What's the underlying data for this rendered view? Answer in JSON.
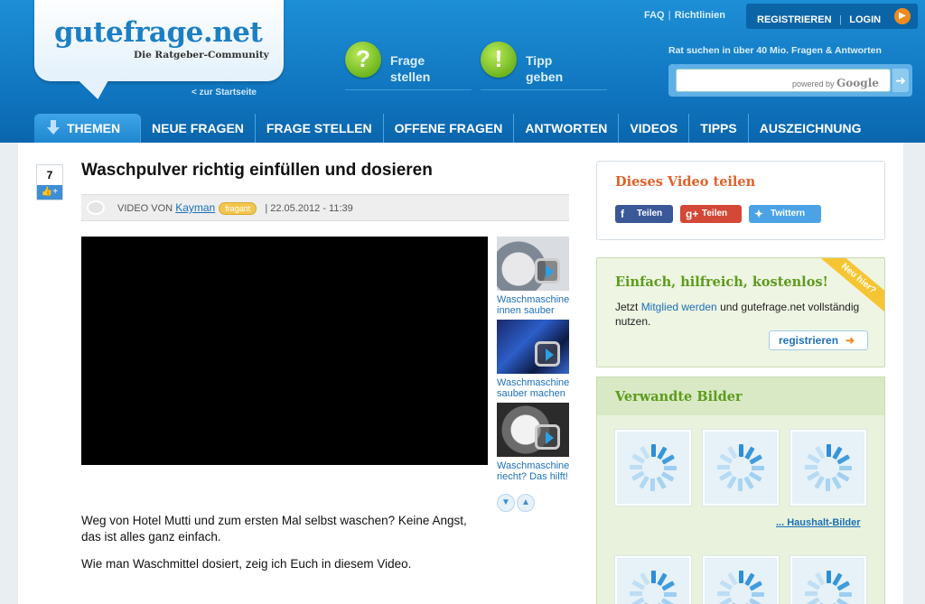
{
  "header": {
    "logo": "gutefrage.net",
    "logo_sub": "Die Ratgeber-Community",
    "start_link": "< zur Startseite",
    "actions": [
      {
        "line1": "Frage",
        "line2": "stellen",
        "icon": "question-mark-icon",
        "glyph": "?"
      },
      {
        "line1": "Tipp",
        "line2": "geben",
        "icon": "exclamation-icon",
        "glyph": "!"
      }
    ],
    "toplinks": {
      "faq": "FAQ",
      "sep": "|",
      "richtlinien": "Richtlinien"
    },
    "auth": {
      "register": "REGISTRIEREN",
      "sep": "|",
      "login": "LOGIN"
    },
    "tagline": "Rat suchen in über 40 Mio. Fragen & Antworten",
    "search": {
      "powered_by": "powered by",
      "brand": "Google"
    }
  },
  "nav": [
    "THEMEN",
    "NEUE FRAGEN",
    "FRAGE STELLEN",
    "OFFENE FRAGEN",
    "ANTWORTEN",
    "VIDEOS",
    "TIPPS",
    "AUSZEICHNUNG"
  ],
  "post": {
    "votes": "7",
    "title": "Waschpulver richtig einfüllen und dosieren",
    "meta_prefix": "VIDEO VON",
    "author": "Kayman",
    "badge": "fragant",
    "date": "| 22.05.2012 - 11:39",
    "description": [
      "Weg von Hotel Mutti und zum ersten Mal selbst waschen? Keine Angst, das ist alles ganz einfach.",
      "Wie man Waschmittel dosiert, zeig ich Euch in diesem Video."
    ]
  },
  "related_videos": [
    {
      "caption": "Waschmaschine innen sauber"
    },
    {
      "caption": "Waschmaschine sauber machen"
    },
    {
      "caption": "Waschmaschine riecht? Das hilft!"
    }
  ],
  "sidebar": {
    "share": {
      "title": "Dieses Video teilen",
      "facebook": "Teilen",
      "google": "Teilen",
      "twitter": "Twittern"
    },
    "newbox": {
      "title": "Einfach, hilfreich, kostenlos!",
      "text_before": "Jetzt",
      "link": "Mitglied werden",
      "text_after": "und gutefrage.net vollständig nutzen.",
      "button": "registrieren",
      "sash": "Neu hier?"
    },
    "related": {
      "title": "Verwandte Bilder",
      "link": "... Haushalt-Bilder"
    }
  },
  "colors": {
    "brand_blue": "#1b7fc4",
    "accent_orange": "#e0622c",
    "accent_green": "#5d9b1c"
  }
}
